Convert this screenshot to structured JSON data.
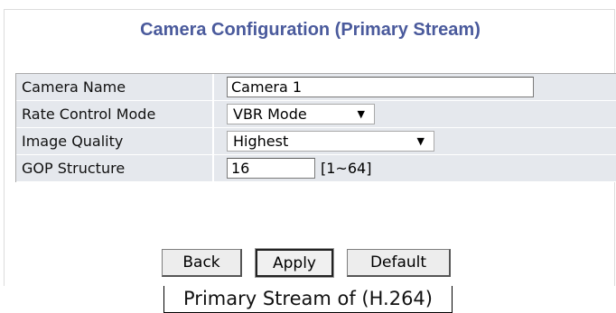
{
  "header": {
    "title": "Camera Configuration (Primary Stream)"
  },
  "fields": {
    "camera_name": {
      "label": "Camera Name",
      "value": "Camera 1"
    },
    "rate_control_mode": {
      "label": "Rate Control Mode",
      "selected": "VBR Mode"
    },
    "image_quality": {
      "label": "Image Quality",
      "selected": "Highest"
    },
    "gop_structure": {
      "label": "GOP Structure",
      "value": "16",
      "range_hint": "[1~64]"
    }
  },
  "buttons": {
    "back": "Back",
    "apply": "Apply",
    "default": "Default"
  },
  "caption": "Primary Stream of (H.264)",
  "colors": {
    "title": "#4a5a9c",
    "row_background": "#e5e8ed"
  }
}
